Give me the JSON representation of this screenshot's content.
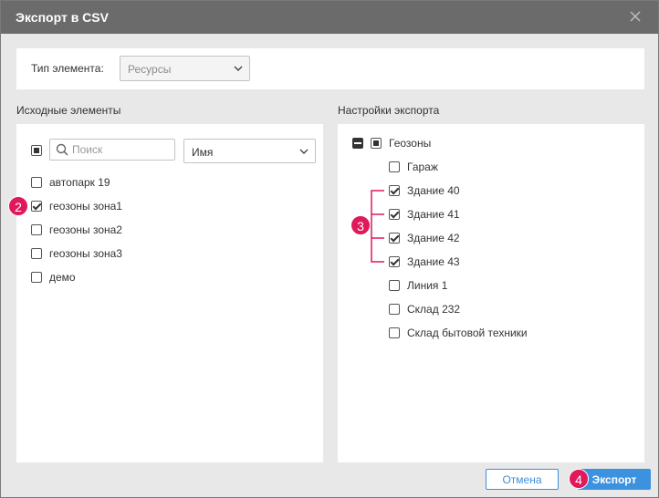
{
  "dialog": {
    "title": "Экспорт в CSV"
  },
  "element_type": {
    "label": "Тип элемента:",
    "value": "Ресурсы"
  },
  "source": {
    "title": "Исходные элементы",
    "search_placeholder": "Поиск",
    "sort_value": "Имя",
    "items": [
      {
        "label": "автопарк  19",
        "checked": false
      },
      {
        "label": "геозоны зона1",
        "checked": true
      },
      {
        "label": "геозоны зона2",
        "checked": false
      },
      {
        "label": "геозоны зона3",
        "checked": false
      },
      {
        "label": "демо",
        "checked": false
      }
    ]
  },
  "settings": {
    "title": "Настройки экспорта",
    "group_label": "Геозоны",
    "items": [
      {
        "label": "Гараж",
        "checked": false
      },
      {
        "label": "Здание 40",
        "checked": true
      },
      {
        "label": "Здание 41",
        "checked": true
      },
      {
        "label": "Здание 42",
        "checked": true
      },
      {
        "label": "Здание 43",
        "checked": true
      },
      {
        "label": "Линия 1",
        "checked": false
      },
      {
        "label": "Склад 232",
        "checked": false
      },
      {
        "label": "Склад бытовой техники",
        "checked": false
      }
    ]
  },
  "badges": {
    "b2": "2",
    "b3": "3",
    "b4": "4"
  },
  "buttons": {
    "cancel": "Отмена",
    "export": "Экспорт"
  },
  "colors": {
    "accent": "#3d92e0",
    "badge": "#e0195a",
    "titlebar": "#6b6b6b"
  }
}
